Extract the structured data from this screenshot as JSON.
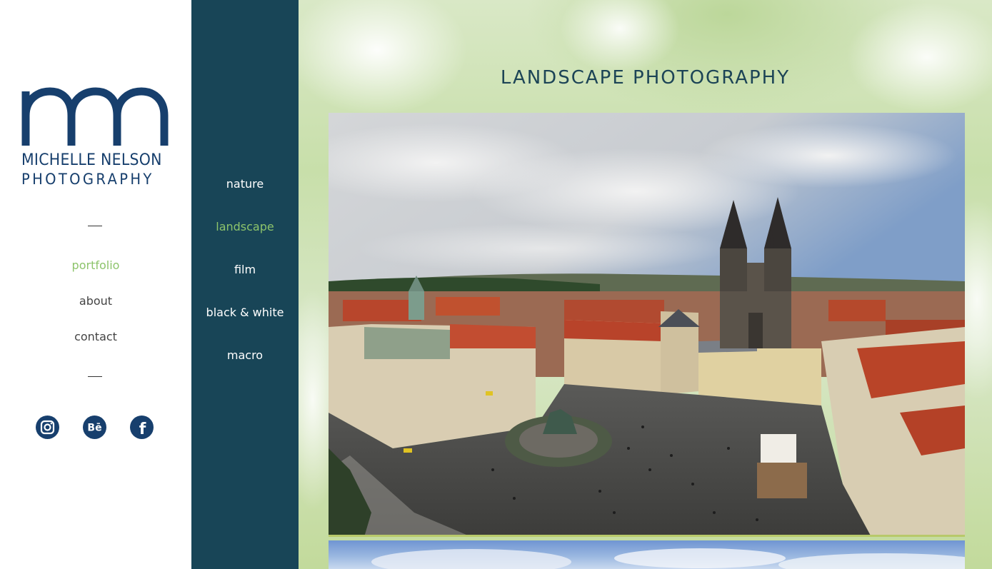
{
  "brand": {
    "line1": "MICHELLE NELSON",
    "line2": "PHOTOGRAPHY",
    "color": "#173f6d"
  },
  "sidebar": {
    "nav": [
      {
        "label": "portfolio",
        "active": true
      },
      {
        "label": "about",
        "active": false
      },
      {
        "label": "contact",
        "active": false
      }
    ],
    "social": [
      {
        "icon": "instagram-icon"
      },
      {
        "icon": "behance-icon",
        "glyph": "Bē"
      },
      {
        "icon": "facebook-icon",
        "glyph": "f"
      }
    ]
  },
  "subnav": {
    "items": [
      {
        "label": "nature",
        "active": false
      },
      {
        "label": "landscape",
        "active": true
      },
      {
        "label": "film",
        "active": false
      },
      {
        "label": "black & white",
        "active": false
      },
      {
        "label": "macro",
        "active": false
      }
    ],
    "background": "#184557",
    "active_color": "#8dc46b"
  },
  "main": {
    "title": "LANDSCAPE PHOTOGRAPHY"
  }
}
